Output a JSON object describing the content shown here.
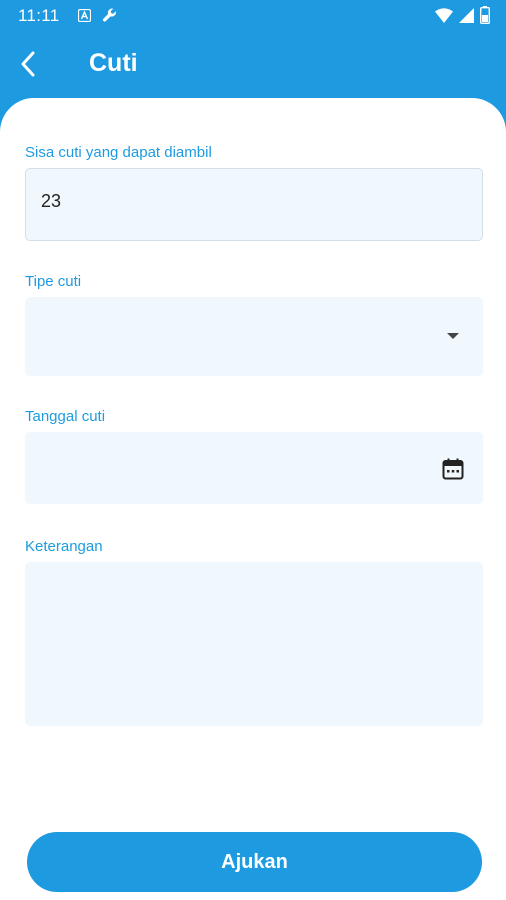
{
  "status_bar": {
    "time": "11:11",
    "left_icons": [
      "accessibility-icon",
      "wrench-icon"
    ],
    "right_icons": [
      "wifi-icon",
      "signal-icon",
      "battery-icon"
    ]
  },
  "header": {
    "title": "Cuti",
    "back_icon": "chevron-left-icon"
  },
  "form": {
    "remaining_leave": {
      "label": "Sisa cuti yang dapat diambil",
      "value": "23"
    },
    "leave_type": {
      "label": "Tipe cuti",
      "value": ""
    },
    "leave_date": {
      "label": "Tanggal cuti",
      "value": ""
    },
    "notes": {
      "label": "Keterangan",
      "value": ""
    }
  },
  "submit": {
    "label": "Ajukan"
  },
  "colors": {
    "primary": "#1E9BE0",
    "field_bg": "#F1F8FD",
    "text": "#222222"
  }
}
